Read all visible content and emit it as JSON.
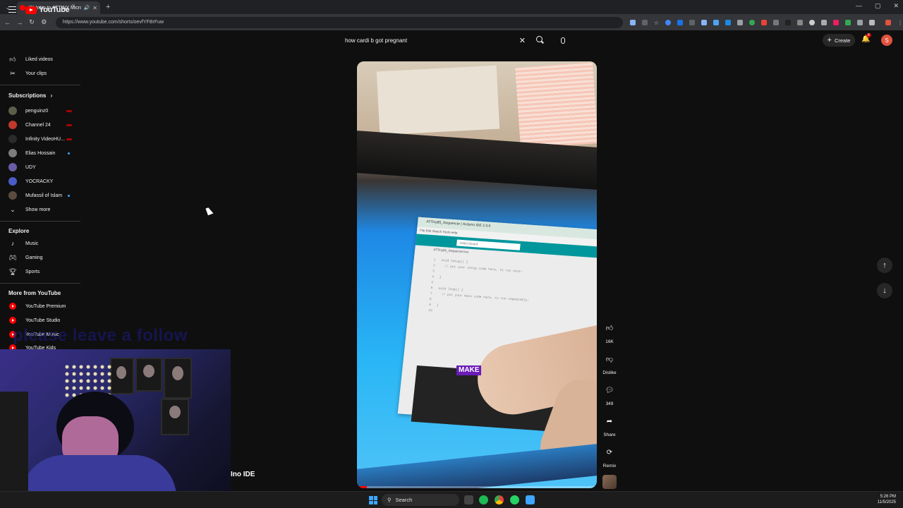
{
  "browser": {
    "tab_title": "(8) Intro to ATTINY Microc...",
    "url": "https://www.youtube.com/shorts/oevfYFBrFuw"
  },
  "youtube": {
    "logo_text": "YouTube",
    "logo_country": "IN",
    "search_query": "how cardi b got pregnant",
    "create_label": "Create",
    "notification_count": "8",
    "user_initial": "S"
  },
  "sidebar": {
    "top_items": [
      {
        "label": "Liked videos",
        "icon": "thumbs-up-icon"
      },
      {
        "label": "Your clips",
        "icon": "scissors-icon"
      }
    ],
    "subscriptions_heading": "Subscriptions",
    "subscriptions": [
      {
        "label": "penguinz0",
        "indicator": "live",
        "color": "#5a5f4a"
      },
      {
        "label": "Channel 24",
        "indicator": "live",
        "color": "#c0392b"
      },
      {
        "label": "Infinity VideoHU...",
        "indicator": "live",
        "color": "#2b2b2b"
      },
      {
        "label": "Elias Hossain",
        "indicator": "dot",
        "color": "#7d7d7d"
      },
      {
        "label": "UDY",
        "indicator": "",
        "color": "#6b5ca5"
      },
      {
        "label": "YOCRACKY",
        "indicator": "",
        "color": "#4a5cc5"
      },
      {
        "label": "Mufassil of Islam",
        "indicator": "dot",
        "color": "#5b4a3e"
      }
    ],
    "show_more": "Show more",
    "explore_heading": "Explore",
    "explore": [
      {
        "label": "Music",
        "icon": "music-note-icon"
      },
      {
        "label": "Gaming",
        "icon": "gamepad-icon"
      },
      {
        "label": "Sports",
        "icon": "trophy-icon"
      }
    ],
    "more_heading": "More from YouTube",
    "more": [
      {
        "label": "YouTube Premium"
      },
      {
        "label": "YouTube Studio"
      },
      {
        "label": "YouTube Music"
      },
      {
        "label": "YouTube Kids"
      }
    ]
  },
  "overlay": {
    "follow_text": "please leave a follow",
    "ino_ide": "Ino IDE"
  },
  "short": {
    "window_title": "ATTiny85_Sequencer | Arduino IDE 2.3.6",
    "menu": "File  Edit  Sketch  Tools  Help",
    "board_select": "Select Board",
    "file_tab": "ATTiny85_Sequencer.ino",
    "code": "1   void setup() {\n2     // put your setup code here, to run once:\n3\n4   }\n5\n6   void loop() {\n7     // put your main code here, to run repeatedly:\n8\n9   }\n10",
    "caption": "MAKE",
    "progress": 0.04
  },
  "actions": {
    "like_count": "16K",
    "dislike_label": "Dislike",
    "comment_count": "349",
    "share_label": "Share",
    "remix_label": "Remix"
  },
  "taskbar": {
    "search_label": "Search",
    "time": "5:26 PM",
    "date": "11/5/2025"
  },
  "colors": {
    "youtube_red": "#ff0000",
    "accent_blue": "#3ea6ff",
    "caption_purple": "#6a1cb8"
  }
}
